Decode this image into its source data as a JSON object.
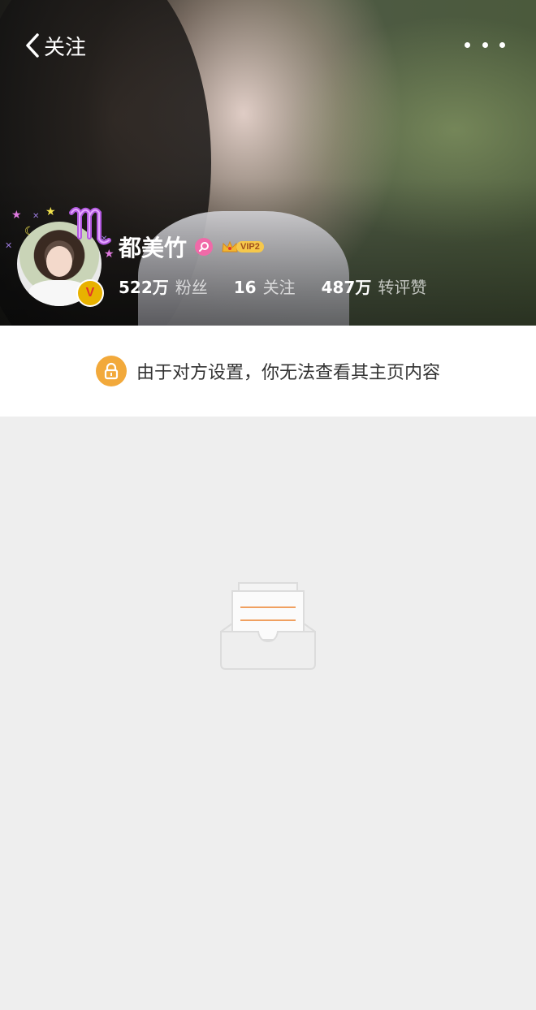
{
  "nav": {
    "back_label": "关注",
    "back_icon": "chevron-left-icon",
    "more_icon": "more-dots-icon"
  },
  "profile": {
    "name": "都美竹",
    "vip_label": "VIP2",
    "verified_badge": "V",
    "stats": [
      {
        "value": "522万",
        "label": "粉丝"
      },
      {
        "value": "16",
        "label": "关注"
      },
      {
        "value": "487万",
        "label": "转评赞"
      }
    ]
  },
  "notice": {
    "text": "由于对方设置，你无法查看其主页内容",
    "icon": "lock-icon"
  },
  "colors": {
    "lock_badge": "#f2a93b",
    "verified_badge": "#e8b200",
    "page_bg": "#eeeeee",
    "empty_accent": "#f0a060"
  }
}
